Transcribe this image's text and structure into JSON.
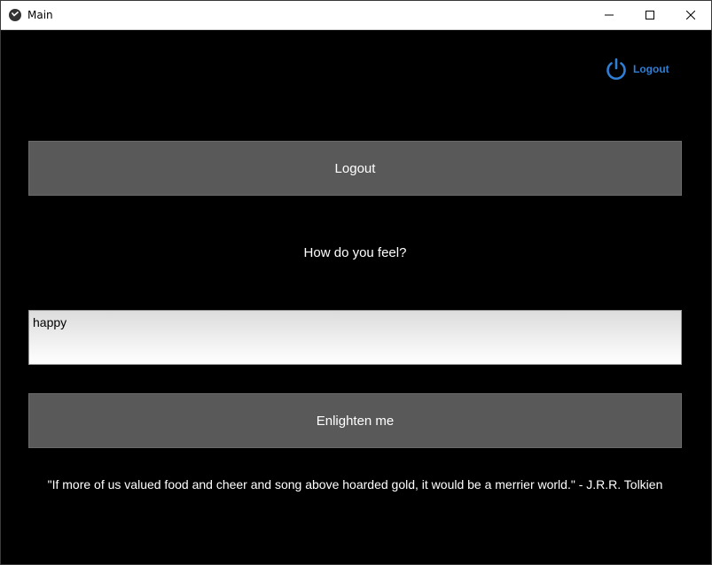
{
  "window": {
    "title": "Main",
    "controls": [
      "minimize-icon",
      "maximize-icon",
      "close-icon"
    ]
  },
  "header": {
    "logout_label": "Logout",
    "logout_icon": "power-icon",
    "accent": "#2f7fd6"
  },
  "main": {
    "logout_button_label": "Logout",
    "question": "How do you feel?",
    "feeling_value": "happy",
    "enlighten_button_label": "Enlighten me",
    "quote": "\"If more of us valued food and cheer and song above hoarded gold, it would be a merrier world.\" - J.R.R. Tolkien"
  },
  "colors": {
    "background": "#000000",
    "button": "#595959",
    "text": "#ffffff"
  }
}
